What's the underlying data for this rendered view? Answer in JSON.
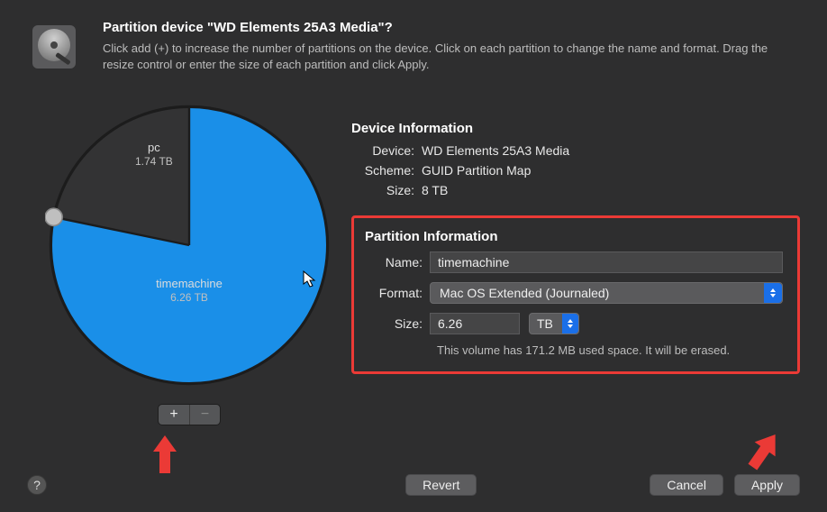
{
  "header": {
    "title": "Partition device \"WD Elements 25A3 Media\"?",
    "subtitle": "Click add (+) to increase the number of partitions on the device. Click on each partition to change the name and format. Drag the resize control or enter the size of each partition and click Apply."
  },
  "device_info": {
    "heading": "Device Information",
    "device_label": "Device:",
    "device_value": "WD Elements 25A3 Media",
    "scheme_label": "Scheme:",
    "scheme_value": "GUID Partition Map",
    "size_label": "Size:",
    "size_value": "8 TB"
  },
  "partition_info": {
    "heading": "Partition Information",
    "name_label": "Name:",
    "name_value": "timemachine",
    "format_label": "Format:",
    "format_value": "Mac OS Extended (Journaled)",
    "size_label": "Size:",
    "size_value": "6.26",
    "size_unit": "TB",
    "note": "This volume has 171.2 MB used space. It will be erased."
  },
  "pie": {
    "pc": {
      "name": "pc",
      "size": "1.74 TB"
    },
    "tm": {
      "name": "timemachine",
      "size": "6.26 TB"
    }
  },
  "buttons": {
    "add": "+",
    "remove": "−",
    "revert": "Revert",
    "cancel": "Cancel",
    "apply": "Apply",
    "help": "?"
  },
  "chart_data": {
    "type": "pie",
    "title": "",
    "slices": [
      {
        "name": "pc",
        "value": 1.74,
        "unit": "TB",
        "color": "#333334"
      },
      {
        "name": "timemachine",
        "value": 6.26,
        "unit": "TB",
        "color": "#1a8fe8"
      }
    ],
    "total": 8.0
  }
}
